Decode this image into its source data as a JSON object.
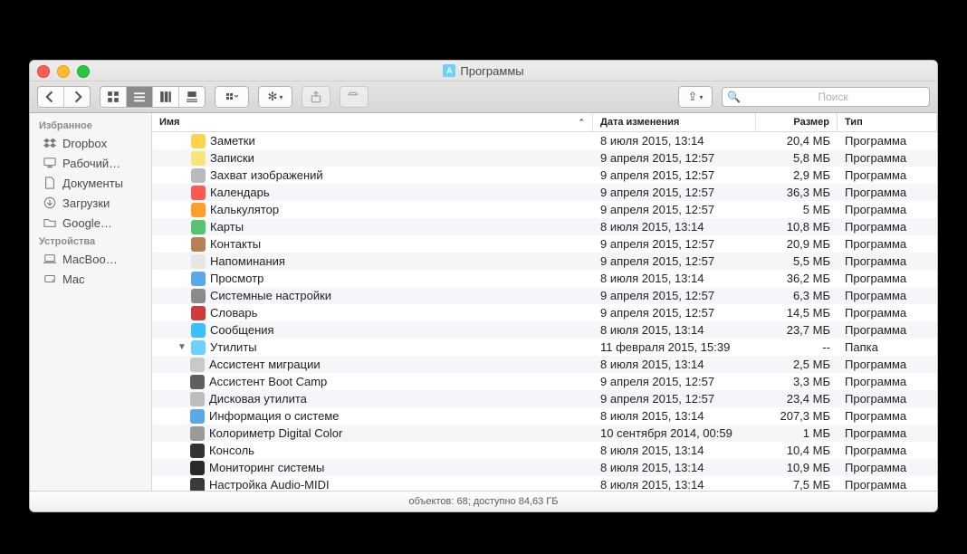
{
  "title": "Программы",
  "search_placeholder": "Поиск",
  "sidebar": {
    "groups": [
      {
        "title": "Избранное",
        "items": [
          {
            "label": "Dropbox",
            "icon": "dropbox"
          },
          {
            "label": "Рабочий…",
            "icon": "desktop"
          },
          {
            "label": "Документы",
            "icon": "doc"
          },
          {
            "label": "Загрузки",
            "icon": "download"
          },
          {
            "label": "Google…",
            "icon": "folder"
          }
        ]
      },
      {
        "title": "Устройства",
        "items": [
          {
            "label": "MacBoo…",
            "icon": "laptop"
          },
          {
            "label": "Mac",
            "icon": "drive"
          }
        ]
      }
    ]
  },
  "columns": {
    "name": "Имя",
    "date": "Дата изменения",
    "size": "Размер",
    "kind": "Тип"
  },
  "rows": [
    {
      "name": "Заметки",
      "date": "8 июля 2015, 13:14",
      "size": "20,4 МБ",
      "kind": "Программа",
      "depth": 0,
      "bg": "#ffd34d"
    },
    {
      "name": "Записки",
      "date": "9 апреля 2015, 12:57",
      "size": "5,8 МБ",
      "kind": "Программа",
      "depth": 0,
      "bg": "#f6e67a"
    },
    {
      "name": "Захват изображений",
      "date": "9 апреля 2015, 12:57",
      "size": "2,9 МБ",
      "kind": "Программа",
      "depth": 0,
      "bg": "#bababa"
    },
    {
      "name": "Календарь",
      "date": "9 апреля 2015, 12:57",
      "size": "36,3 МБ",
      "kind": "Программа",
      "depth": 0,
      "bg": "#ff5a4c"
    },
    {
      "name": "Калькулятор",
      "date": "9 апреля 2015, 12:57",
      "size": "5 МБ",
      "kind": "Программа",
      "depth": 0,
      "bg": "#ff9e2c"
    },
    {
      "name": "Карты",
      "date": "8 июля 2015, 13:14",
      "size": "10,8 МБ",
      "kind": "Программа",
      "depth": 0,
      "bg": "#58c36d"
    },
    {
      "name": "Контакты",
      "date": "9 апреля 2015, 12:57",
      "size": "20,9 МБ",
      "kind": "Программа",
      "depth": 0,
      "bg": "#b78055"
    },
    {
      "name": "Напоминания",
      "date": "9 апреля 2015, 12:57",
      "size": "5,5 МБ",
      "kind": "Программа",
      "depth": 0,
      "bg": "#e6e6e6"
    },
    {
      "name": "Просмотр",
      "date": "8 июля 2015, 13:14",
      "size": "36,2 МБ",
      "kind": "Программа",
      "depth": 0,
      "bg": "#5aa8e6"
    },
    {
      "name": "Системные настройки",
      "date": "9 апреля 2015, 12:57",
      "size": "6,3 МБ",
      "kind": "Программа",
      "depth": 0,
      "bg": "#8b8b8b"
    },
    {
      "name": "Словарь",
      "date": "9 апреля 2015, 12:57",
      "size": "14,5 МБ",
      "kind": "Программа",
      "depth": 0,
      "bg": "#d23a3a"
    },
    {
      "name": "Сообщения",
      "date": "8 июля 2015, 13:14",
      "size": "23,7 МБ",
      "kind": "Программа",
      "depth": 0,
      "bg": "#39c0ff"
    },
    {
      "name": "Утилиты",
      "date": "11 февраля 2015, 15:39",
      "size": "--",
      "kind": "Папка",
      "depth": 0,
      "bg": "#6bd1ff",
      "folder": true,
      "expanded": true
    },
    {
      "name": "Ассистент миграции",
      "date": "8 июля 2015, 13:14",
      "size": "2,5 МБ",
      "kind": "Программа",
      "depth": 1,
      "bg": "#c9c9c9"
    },
    {
      "name": "Ассистент Boot Camp",
      "date": "9 апреля 2015, 12:57",
      "size": "3,3 МБ",
      "kind": "Программа",
      "depth": 1,
      "bg": "#5f5f5f"
    },
    {
      "name": "Дисковая утилита",
      "date": "9 апреля 2015, 12:57",
      "size": "23,4 МБ",
      "kind": "Программа",
      "depth": 1,
      "bg": "#bdbdbd"
    },
    {
      "name": "Информация о системе",
      "date": "8 июля 2015, 13:14",
      "size": "207,3 МБ",
      "kind": "Программа",
      "depth": 1,
      "bg": "#5aa8e6"
    },
    {
      "name": "Колориметр Digital Color",
      "date": "10 сентября 2014, 00:59",
      "size": "1 МБ",
      "kind": "Программа",
      "depth": 1,
      "bg": "#9a9a9a"
    },
    {
      "name": "Консоль",
      "date": "8 июля 2015, 13:14",
      "size": "10,4 МБ",
      "kind": "Программа",
      "depth": 1,
      "bg": "#333333"
    },
    {
      "name": "Мониторинг системы",
      "date": "8 июля 2015, 13:14",
      "size": "10,9 МБ",
      "kind": "Программа",
      "depth": 1,
      "bg": "#2a2a2a"
    },
    {
      "name": "Настройка Audio-MIDI",
      "date": "8 июля 2015, 13:14",
      "size": "7,5 МБ",
      "kind": "Программа",
      "depth": 1,
      "bg": "#3a3a3a"
    }
  ],
  "status": "объектов: 68; доступно 84,63 ГБ"
}
